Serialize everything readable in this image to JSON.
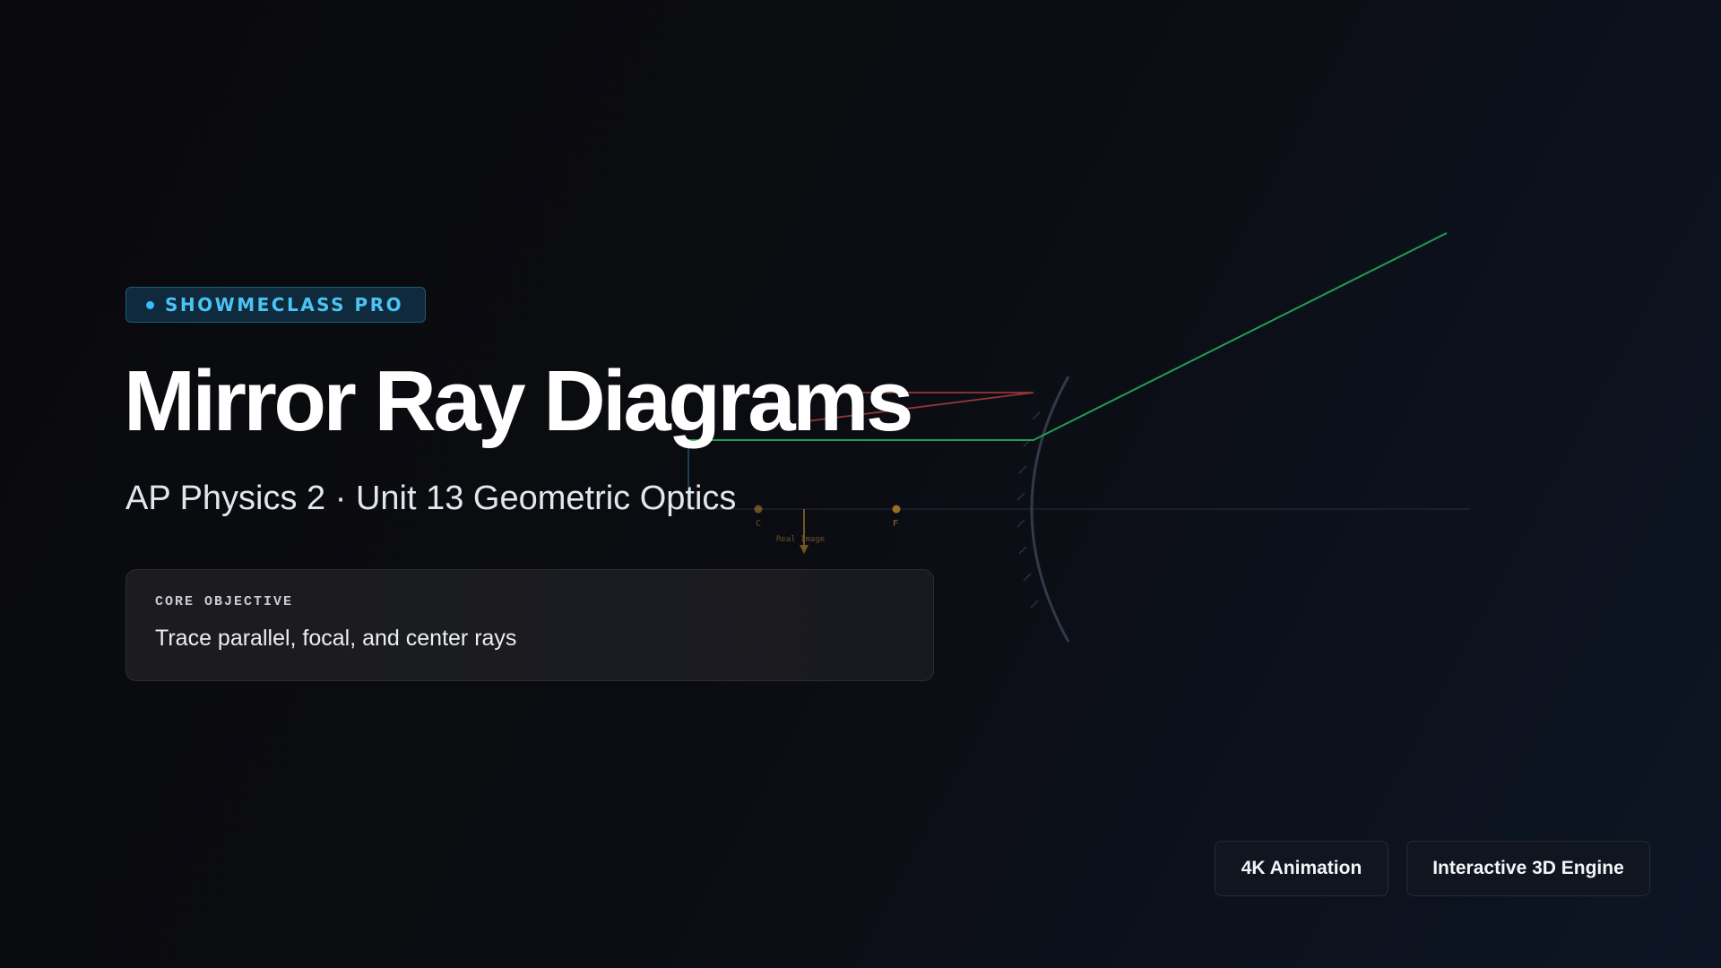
{
  "brand": {
    "badge_label": "SHOWMECLASS PRO",
    "accent_color": "#38bdf8"
  },
  "hero": {
    "title": "Mirror Ray Diagrams",
    "subtitle": "AP Physics 2 · Unit 13 Geometric Optics"
  },
  "objective": {
    "label": "CORE OBJECTIVE",
    "text": "Trace parallel, focal, and center rays"
  },
  "features": [
    {
      "label": "4K Animation"
    },
    {
      "label": "Interactive 3D Engine"
    }
  ],
  "diagram": {
    "center_label": "C",
    "focus_label": "F",
    "image_label": "Real Image",
    "colors": {
      "parallel_ray": "#22a55a",
      "center_ray": "#d04848",
      "focal_point": "#b8862e",
      "object_arrow": "#1f6f8b",
      "mirror": "#394152"
    }
  }
}
